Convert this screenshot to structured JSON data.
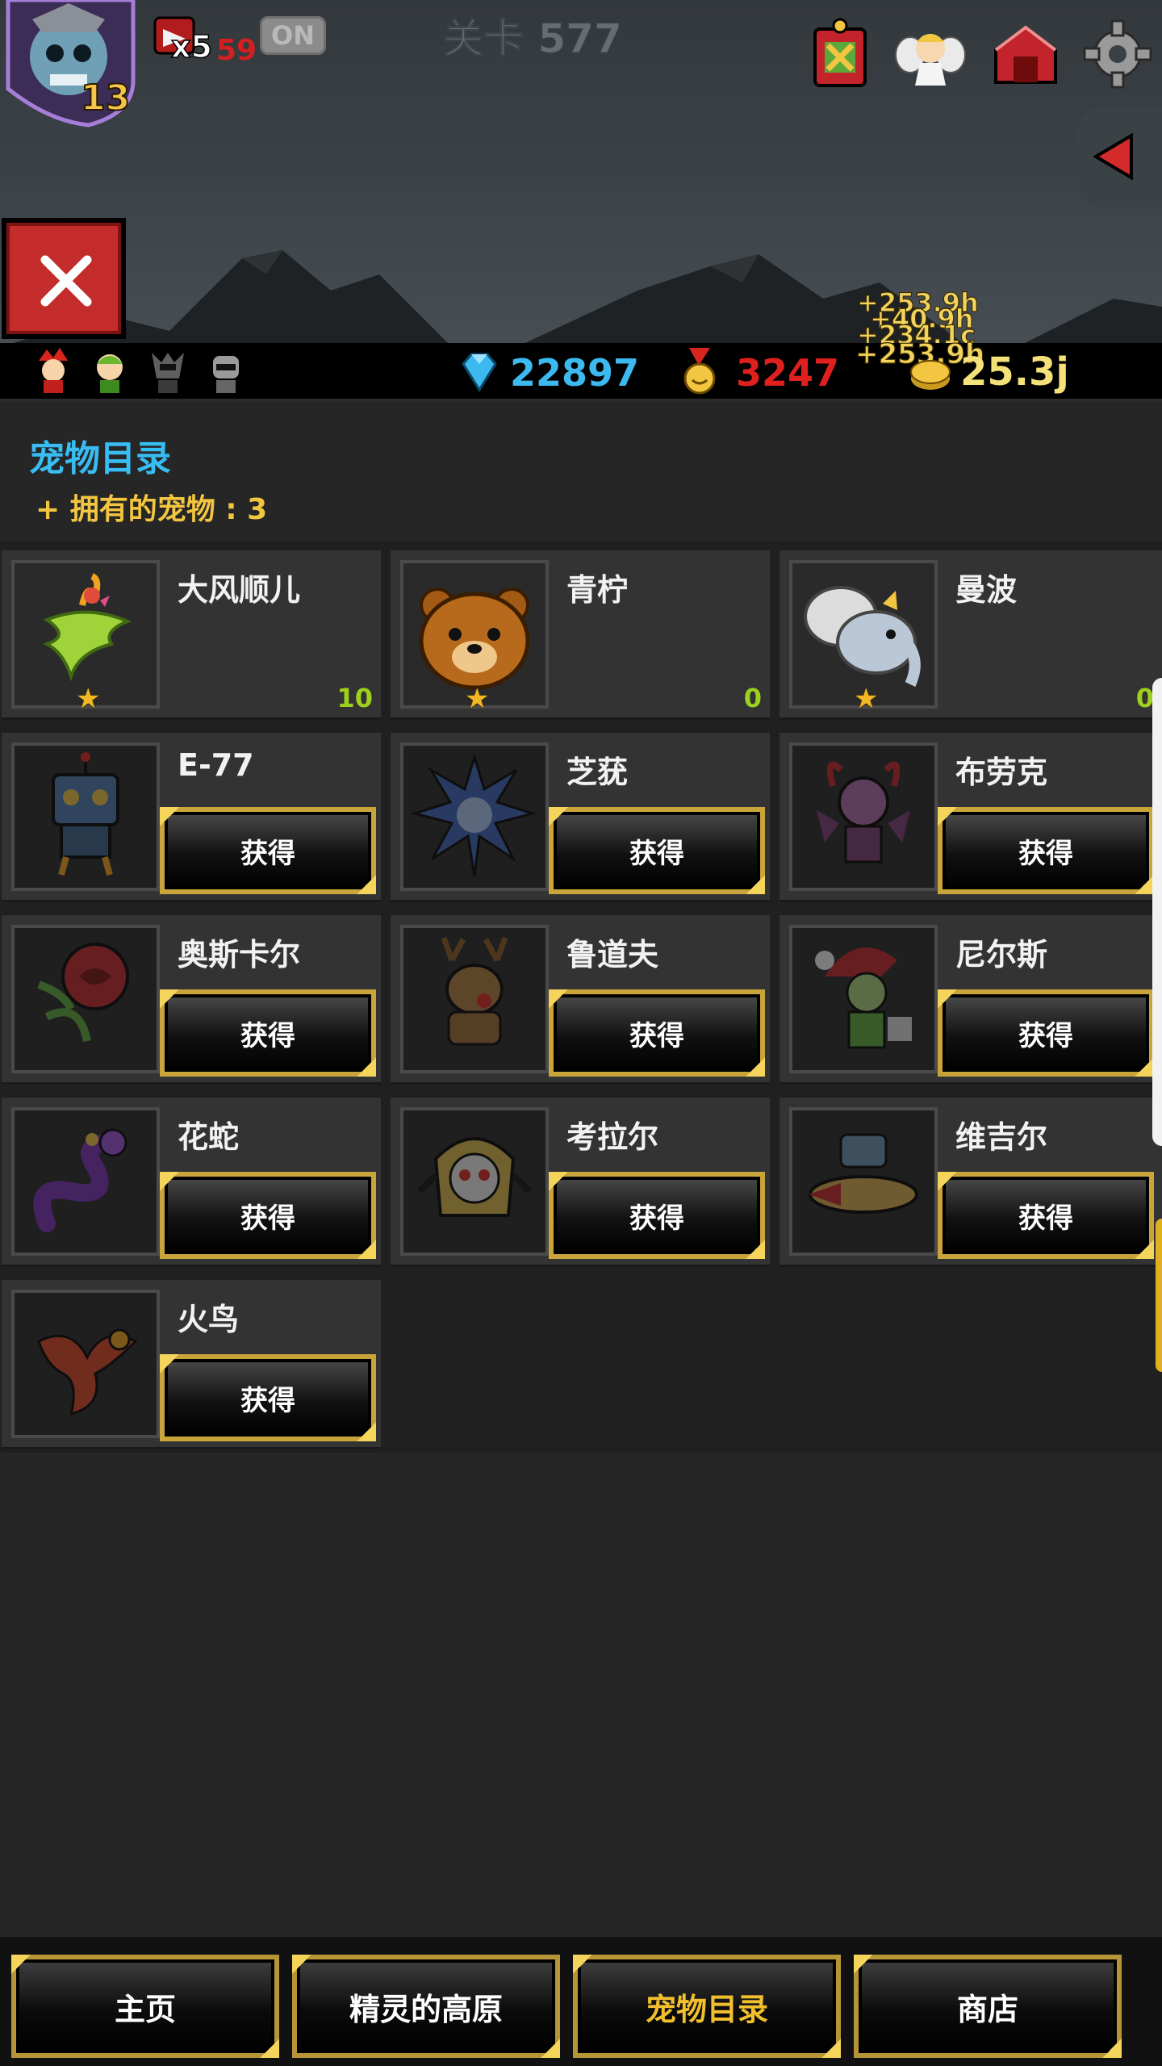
{
  "header": {
    "player_level": "13",
    "lives_count": "x5",
    "lives_timer": "59",
    "auto_toggle": "ON",
    "stage_label": "关卡 577"
  },
  "resources": {
    "gems": "22897",
    "medals": "3247",
    "gold": "25.3j",
    "floating_gains": [
      "+253.9h",
      "+40.9h",
      "+234.1c",
      "+253.9h"
    ]
  },
  "catalog": {
    "title": "宠物目录",
    "owned_label": "+ 拥有的宠物 : 3"
  },
  "pets": [
    {
      "name": "大风顺儿",
      "count": "10",
      "owned": true,
      "icon": "tornado-pet-icon"
    },
    {
      "name": "青柠",
      "count": "0",
      "owned": true,
      "icon": "bear-pet-icon"
    },
    {
      "name": "曼波",
      "count": "0",
      "owned": true,
      "icon": "elephant-pet-icon"
    },
    {
      "name": "E-77",
      "button": "获得",
      "owned": false,
      "icon": "robot-pet-icon"
    },
    {
      "name": "芝莸",
      "button": "获得",
      "owned": false,
      "icon": "spiky-pet-icon"
    },
    {
      "name": "布劳克",
      "button": "获得",
      "owned": false,
      "icon": "demon-pet-icon"
    },
    {
      "name": "奥斯卡尔",
      "button": "获得",
      "owned": false,
      "icon": "rose-pet-icon"
    },
    {
      "name": "鲁道夫",
      "button": "获得",
      "owned": false,
      "icon": "reindeer-pet-icon"
    },
    {
      "name": "尼尔斯",
      "button": "获得",
      "owned": false,
      "icon": "elf-pet-icon"
    },
    {
      "name": "花蛇",
      "button": "获得",
      "owned": false,
      "icon": "snake-pet-icon"
    },
    {
      "name": "考拉尔",
      "button": "获得",
      "owned": false,
      "icon": "pharaoh-pet-icon"
    },
    {
      "name": "维吉尔",
      "button": "获得",
      "owned": false,
      "icon": "plane-pet-icon"
    },
    {
      "name": "火鸟",
      "button": "获得",
      "owned": false,
      "icon": "phoenix-pet-icon"
    }
  ],
  "nav": {
    "home": "主页",
    "spirit_plateau": "精灵的高原",
    "pet_catalog": "宠物目录",
    "shop": "商店"
  },
  "colors": {
    "gem": "#3cb9ef",
    "medal": "#e01f1f",
    "gold": "#f4e278",
    "button_border": "#c8a43a",
    "active_nav": "#f2c02f"
  }
}
